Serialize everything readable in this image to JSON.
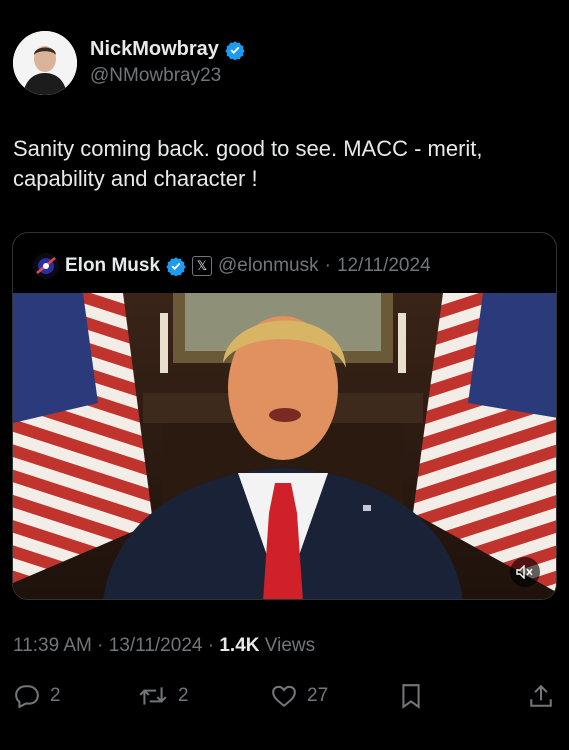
{
  "author": {
    "display_name": "NickMowbray",
    "handle": "@NMowbray23",
    "verified": true
  },
  "tweet": {
    "text": "Sanity coming back. good to see. MACC - merit, capability and character !"
  },
  "quoted": {
    "name": "Elon Musk",
    "verified": true,
    "affiliate_badge": "𝕏",
    "handle": "@elonmusk",
    "separator": "·",
    "date": "12/11/2024",
    "media_type": "video"
  },
  "meta": {
    "time": "11:39 AM",
    "separator": "·",
    "date": "13/11/2024",
    "views_count": "1.4K",
    "views_label": "Views"
  },
  "actions": {
    "replies": "2",
    "reposts": "2",
    "likes": "27"
  },
  "icons": {
    "reply": "reply-icon",
    "repost": "repost-icon",
    "like": "heart-icon",
    "bookmark": "bookmark-icon",
    "share": "share-icon",
    "mute": "muted-speaker-icon",
    "verified": "verified-badge-icon"
  },
  "colors": {
    "background": "#000000",
    "text": "#e7e9ea",
    "muted": "#71767b",
    "verified": "#1d9bf0",
    "border": "#2f3336"
  }
}
